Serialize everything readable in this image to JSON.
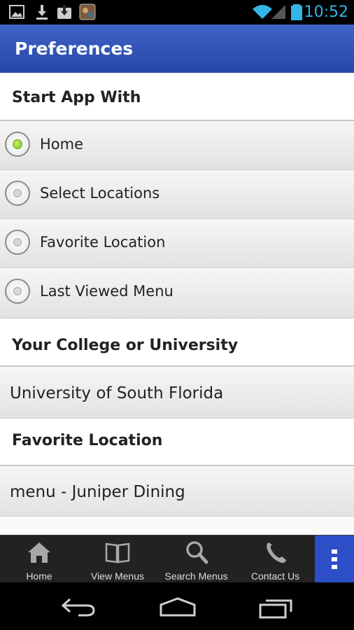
{
  "status_bar": {
    "time": "10:52",
    "left_icons": [
      "picture-icon",
      "download-icon",
      "download-box-icon",
      "app-thumbnail-icon"
    ],
    "right_icons": [
      "wifi-icon",
      "signal-icon",
      "battery-icon"
    ]
  },
  "action_bar": {
    "title": "Preferences"
  },
  "sections": {
    "start_app": {
      "header": "Start App With",
      "options": [
        {
          "label": "Home",
          "selected": true
        },
        {
          "label": "Select Locations",
          "selected": false
        },
        {
          "label": "Favorite Location",
          "selected": false
        },
        {
          "label": "Last Viewed Menu",
          "selected": false
        }
      ]
    },
    "college": {
      "header": "Your College or University",
      "value": "University of South Florida"
    },
    "favorite": {
      "header": "Favorite Location",
      "value": "menu - Juniper Dining"
    }
  },
  "tab_bar": {
    "tabs": [
      {
        "label": "Home",
        "icon": "home-icon"
      },
      {
        "label": "View Menus",
        "icon": "book-icon"
      },
      {
        "label": "Search Menus",
        "icon": "search-icon"
      },
      {
        "label": "Contact Us",
        "icon": "phone-icon"
      }
    ],
    "overflow_icon": "overflow-menu-icon",
    "overflow_color": "#2c4fc7"
  },
  "nav_bar": {
    "icons": [
      "back-icon",
      "home-nav-icon",
      "recent-apps-icon"
    ]
  },
  "colors": {
    "action_bar": "#3252b8",
    "accent_blue": "#33b5e5",
    "radio_selected": "#7cc21b"
  }
}
